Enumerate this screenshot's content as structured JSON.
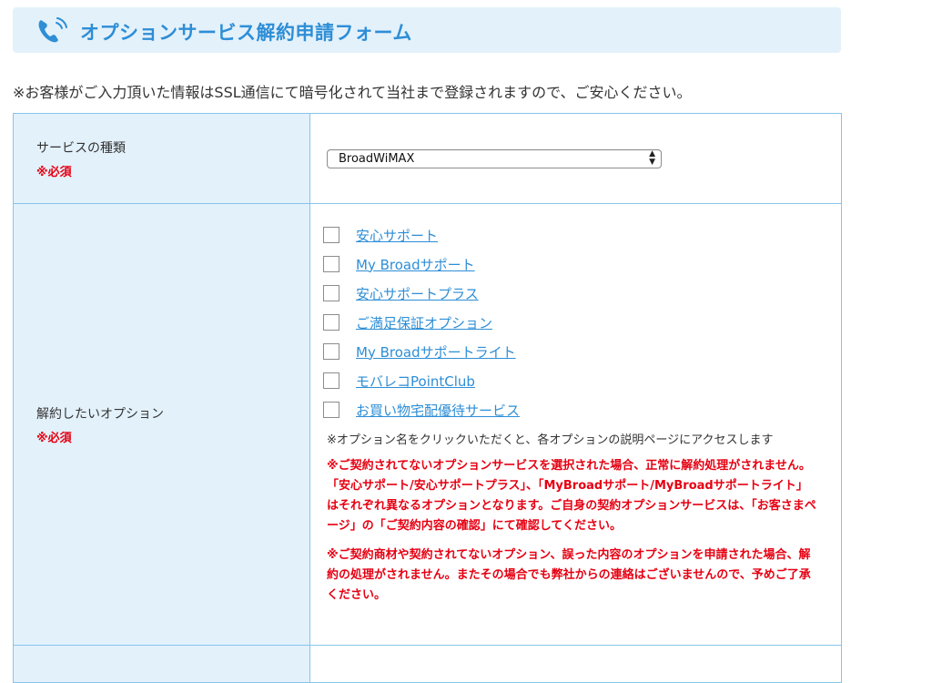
{
  "header": {
    "title": "オプションサービス解約申請フォーム",
    "icon": "phone-icon"
  },
  "notice": "※お客様がご入力頂いた情報はSSL通信にて暗号化されて当社まで登録されますので、ご安心ください。",
  "form": {
    "service": {
      "label": "サービスの種類",
      "required": "※必須",
      "selected": "BroadWiMAX"
    },
    "options": {
      "label": "解約したいオプション",
      "required": "※必須",
      "items": [
        "安心サポート",
        "My Broadサポート",
        "安心サポートプラス",
        "ご満足保証オプション",
        "My Broadサポートライト",
        "モバレコPointClub",
        "お買い物宅配優待サービス"
      ],
      "hint": "※オプション名をクリックいただくと、各オプションの説明ページにアクセスします",
      "warning1": "※ご契約されてないオプションサービスを選択された場合、正常に解約処理がされません。",
      "warning2": "「安心サポート/安心サポートプラス」、「MyBroadサポート/MyBroadサポートライト」はそれぞれ異なるオプションとなります。ご自身の契約オプションサービスは、「お客さまページ」の「ご契約内容の確認」にて確認してください。",
      "warning3": "※ご契約商材や契約されてないオプション、誤った内容のオプションを申請された場合、解約の処理がされません。またその場合でも弊社からの連絡はございませんので、予めご了承ください。"
    }
  },
  "colors": {
    "accent": "#2e8ed6",
    "label_bg": "#e3f1fb",
    "required": "#e60012",
    "border": "#86c5ea"
  }
}
